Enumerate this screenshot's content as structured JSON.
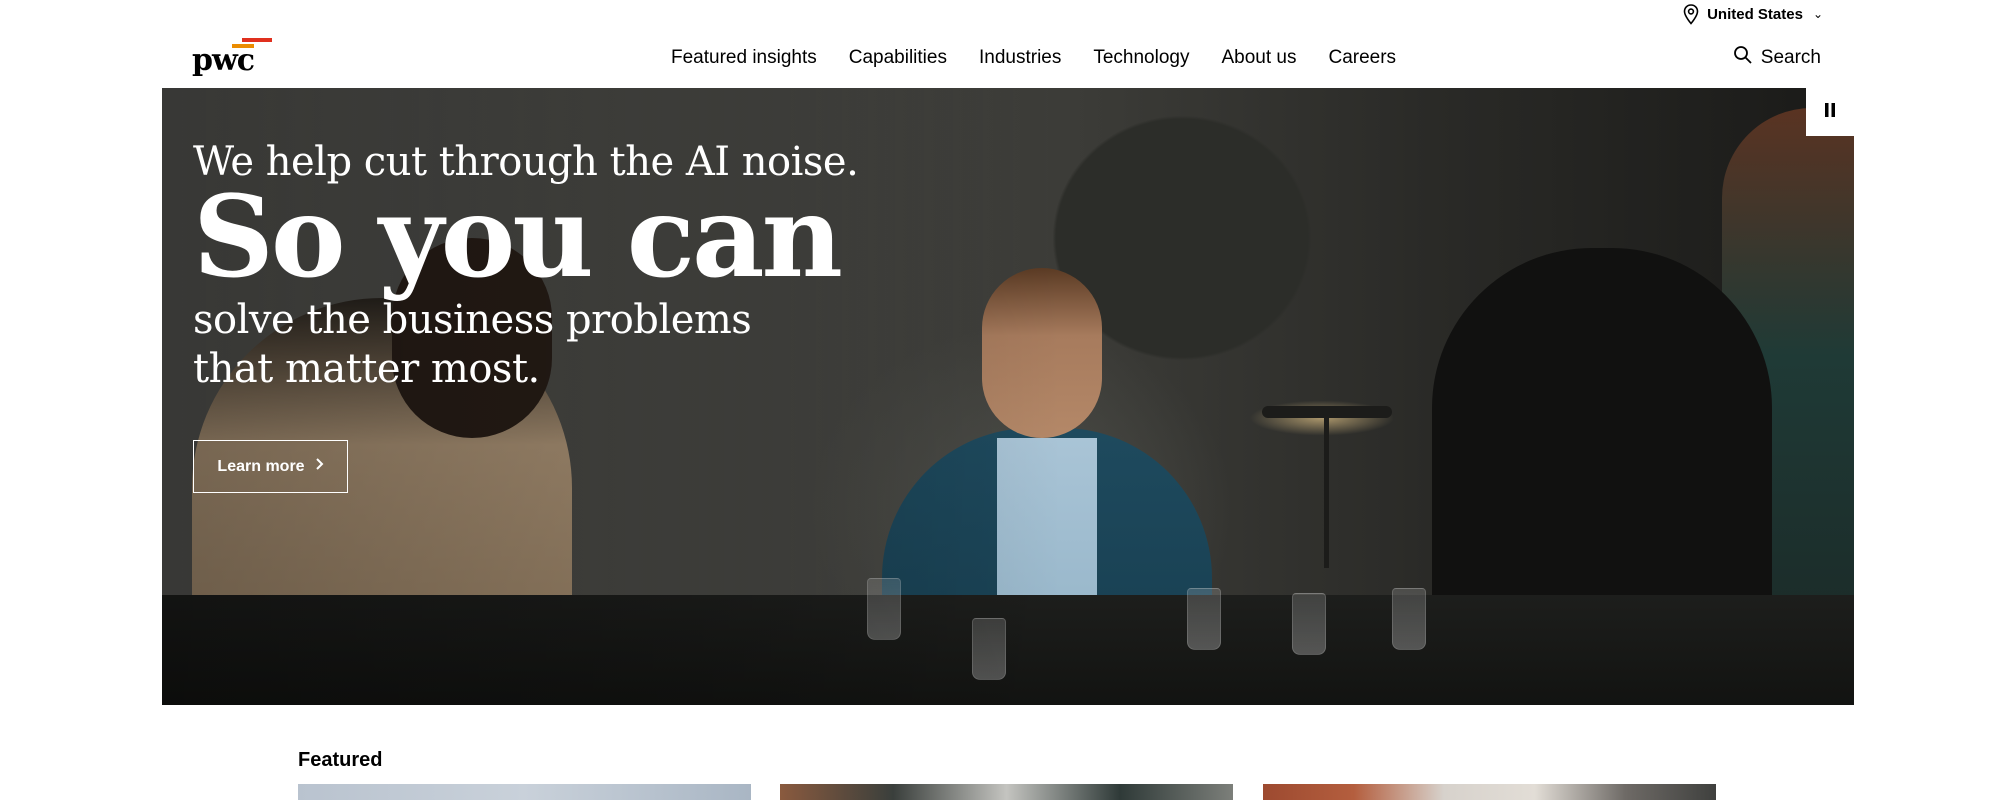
{
  "utility": {
    "region_label": "United States",
    "pin_icon": "location-pin-icon",
    "chevron_icon": "chevron-down-icon"
  },
  "header": {
    "logo_text": "pwc",
    "logo_color": "#e0301e",
    "nav": [
      {
        "label": "Featured insights"
      },
      {
        "label": "Capabilities"
      },
      {
        "label": "Industries"
      },
      {
        "label": "Technology"
      },
      {
        "label": "About us"
      },
      {
        "label": "Careers"
      }
    ],
    "search_label": "Search",
    "search_icon": "search-icon"
  },
  "hero": {
    "lead": "We help cut through the AI noise.",
    "headline": "So you can",
    "subline": "solve the business problems that matter most.",
    "cta_label": "Learn more",
    "cta_icon": "chevron-right-icon",
    "pause_icon": "pause-icon"
  },
  "featured": {
    "title": "Featured"
  }
}
